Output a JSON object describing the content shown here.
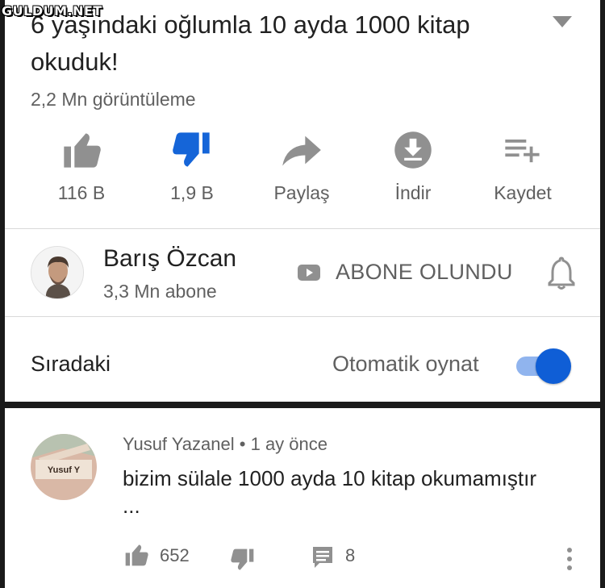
{
  "watermark": "GULDUM.NET",
  "video": {
    "title": "6 yaşındaki oğlumla 10 ayda 1000 kitap okuduk!",
    "views": "2,2 Mn görüntüleme"
  },
  "actions": {
    "like": "116 B",
    "dislike": "1,9 B",
    "share": "Paylaş",
    "download": "İndir",
    "save": "Kaydet"
  },
  "channel": {
    "name": "Barış Özcan",
    "subscribers": "3,3 Mn abone",
    "subscribe_label": "ABONE OLUNDU"
  },
  "upnext": {
    "label": "Sıradaki",
    "autoplay_label": "Otomatik oynat",
    "autoplay_on": true
  },
  "comment": {
    "author": "Yusuf Yazanel",
    "separator": "•",
    "time": "1 ay önce",
    "text": "bizim sülale 1000 ayda 10 kitap okumamıştır ...",
    "avatar_text": "Yusuf Y",
    "likes": "652",
    "replies": "8"
  },
  "colors": {
    "dislike_active": "#1565d8",
    "toggle_knob": "#0f5ed6",
    "toggle_track": "#90b4ee",
    "icon_grey": "#909090"
  },
  "icons": [
    "chevron-down-icon",
    "thumb-up-icon",
    "thumb-down-icon",
    "share-icon",
    "download-icon",
    "add-to-playlist-icon",
    "subscribe-icon",
    "bell-icon",
    "reply-icon",
    "more-vert-icon"
  ]
}
